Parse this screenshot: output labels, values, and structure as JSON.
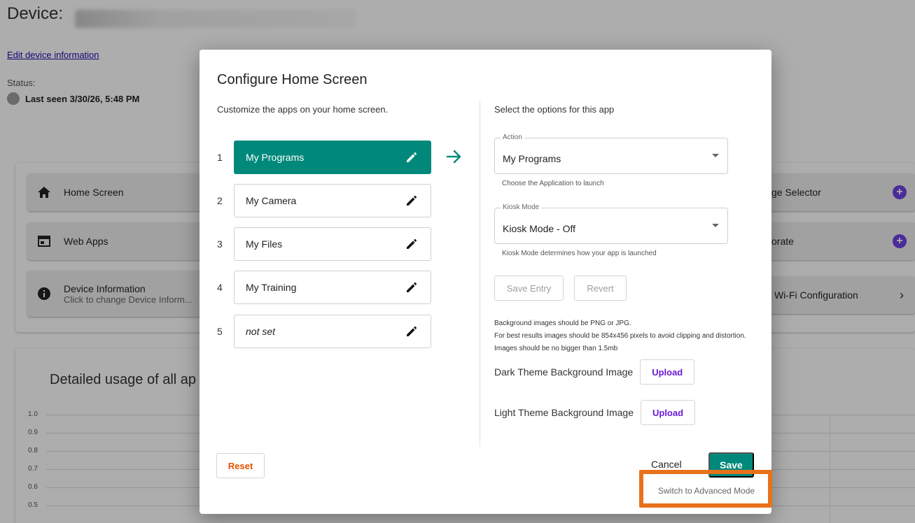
{
  "page": {
    "title": "Device:",
    "edit_link": "Edit device information",
    "status_label": "Status:",
    "last_seen": "Last seen 3/30/26, 5:48 PM",
    "tiles": {
      "home_screen": "Home Screen",
      "web_apps": "Web Apps",
      "device_info_title": "Device Information",
      "device_info_sub": "Click to change Device Inform...",
      "right1": "ge Selector",
      "right2": "orate",
      "right3": "Wi-Fi Configuration"
    },
    "usage_title": "Detailed usage of all ap",
    "y_ticks": [
      "1.0",
      "0.9",
      "0.8",
      "0.7",
      "0.6",
      "0.5"
    ]
  },
  "dialog": {
    "title": "Configure Home Screen",
    "subtitle": "Customize the apps on your home screen.",
    "slots": [
      {
        "num": "1",
        "label": "My Programs"
      },
      {
        "num": "2",
        "label": "My Camera"
      },
      {
        "num": "3",
        "label": "My Files"
      },
      {
        "num": "4",
        "label": "My Training"
      },
      {
        "num": "5",
        "label": "not set"
      }
    ],
    "options_heading": "Select the options for this app",
    "action": {
      "legend": "Action",
      "value": "My Programs",
      "helper": "Choose the Application to launch"
    },
    "kiosk": {
      "legend": "Kiosk Mode",
      "value": "Kiosk Mode - Off",
      "helper": "Kiosk Mode determines how your app is launched"
    },
    "save_entry": "Save Entry",
    "revert": "Revert",
    "note_line1": "Background images should be PNG or JPG.",
    "note_line2": "For best results images should be 854x456 pixels to avoid clipping and distortion. Images should be no bigger than 1.5mb",
    "dark_label": "Dark Theme Background Image",
    "light_label": "Light Theme Background Image",
    "upload": "Upload",
    "reset": "Reset",
    "cancel": "Cancel",
    "save": "Save",
    "advanced": "Switch to Advanced Mode"
  },
  "colors": {
    "accent": "#00897b",
    "upload": "#6a1bd6",
    "reset": "#e65100",
    "highlight": "#e8711b"
  }
}
